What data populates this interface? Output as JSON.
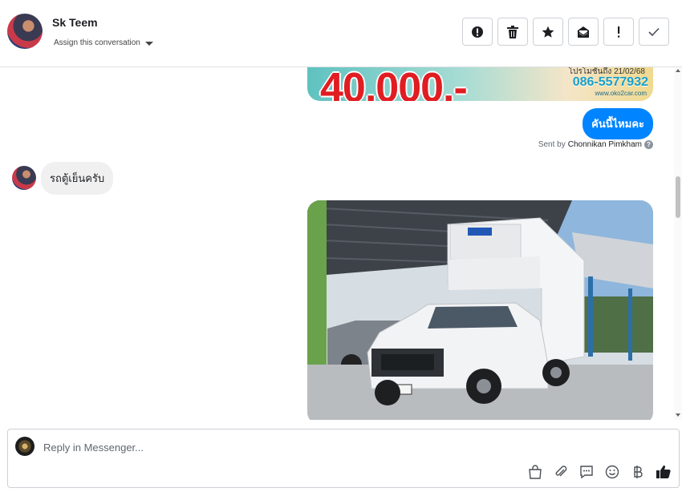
{
  "header": {
    "contact_name": "Sk Teem",
    "assign_label": "Assign this conversation",
    "actions": [
      {
        "name": "report-spam-button",
        "icon": "alert-circle-icon"
      },
      {
        "name": "delete-button",
        "icon": "trash-icon"
      },
      {
        "name": "star-button",
        "icon": "star-icon"
      },
      {
        "name": "mark-unread-button",
        "icon": "envelope-icon"
      },
      {
        "name": "follow-up-button",
        "icon": "exclamation-icon"
      },
      {
        "name": "mark-done-button",
        "icon": "check-icon"
      }
    ]
  },
  "thread": {
    "banner": {
      "price": "40,000.-",
      "promo": "โปรโมชั่นถึง 21/02/68",
      "phone": "086-5577932",
      "website": "www.oko2car.com"
    },
    "outgoing_message": "คันนี้ไหมคะ",
    "sent_by_prefix": "Sent by",
    "sent_by_name": "Chonnikan Pimkham",
    "incoming_message": "รถตู้เย็นครับ",
    "photo_plate": "2ฒข 3615"
  },
  "composer": {
    "placeholder": "Reply in Messenger...",
    "tools": [
      "bag-icon",
      "paperclip-icon",
      "saved-reply-icon",
      "emoji-icon",
      "baht-icon",
      "thumbs-up-icon"
    ]
  },
  "colors": {
    "messenger_blue": "#0084ff",
    "incoming_bubble": "#f0f0f0",
    "border": "#ccd0d5"
  }
}
